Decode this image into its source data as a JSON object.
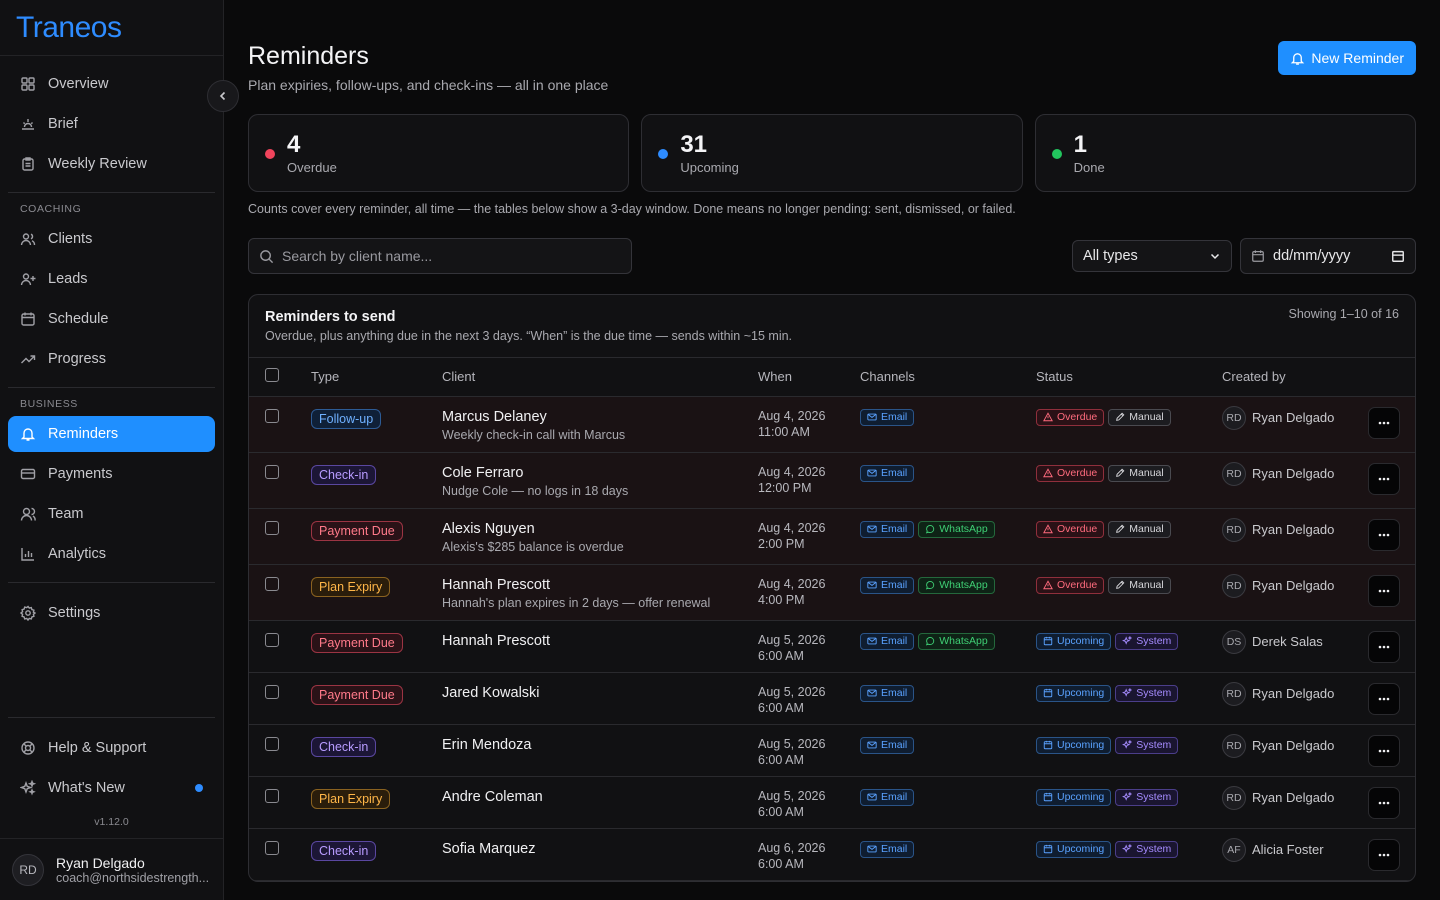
{
  "brand": {
    "name": "Traneos"
  },
  "sidebar": {
    "top_items": [
      {
        "label": "Overview",
        "icon": "grid-icon"
      },
      {
        "label": "Brief",
        "icon": "sunrise-icon"
      },
      {
        "label": "Weekly Review",
        "icon": "clipboard-icon"
      }
    ],
    "coaching_label": "COACHING",
    "coaching_items": [
      {
        "label": "Clients",
        "icon": "users-icon"
      },
      {
        "label": "Leads",
        "icon": "user-plus-icon"
      },
      {
        "label": "Schedule",
        "icon": "calendar-icon"
      },
      {
        "label": "Progress",
        "icon": "trending-up-icon"
      }
    ],
    "business_label": "BUSINESS",
    "business_items": [
      {
        "label": "Reminders",
        "icon": "bell-icon",
        "active": true
      },
      {
        "label": "Payments",
        "icon": "credit-card-icon"
      },
      {
        "label": "Team",
        "icon": "team-icon"
      },
      {
        "label": "Analytics",
        "icon": "bar-chart-icon"
      }
    ],
    "settings_label": "Settings",
    "help_label": "Help & Support",
    "whats_new_label": "What's New",
    "version": "v1.12.0",
    "user": {
      "initials": "RD",
      "name": "Ryan Delgado",
      "email": "coach@northsidestrength..."
    }
  },
  "header": {
    "title": "Reminders",
    "subtitle": "Plan expiries, follow-ups, and check-ins — all in one place",
    "new_button": "New Reminder"
  },
  "stats": [
    {
      "value": "4",
      "label": "Overdue",
      "color": "#f0445c"
    },
    {
      "value": "31",
      "label": "Upcoming",
      "color": "#2e8cff"
    },
    {
      "value": "1",
      "label": "Done",
      "color": "#22c55e"
    }
  ],
  "stats_note": "Counts cover every reminder, all time — the tables below show a 3-day window. Done means no longer pending: sent, dismissed, or failed.",
  "filters": {
    "search_placeholder": "Search by client name...",
    "type_select": "All types",
    "date_placeholder": "dd/mm/yyyy"
  },
  "panel": {
    "title": "Reminders to send",
    "subtitle": "Overdue, plus anything due in the next 3 days. “When” is the due time — sends within ~15 min.",
    "showing": "Showing 1–10 of 16",
    "columns": {
      "type": "Type",
      "client": "Client",
      "when": "When",
      "channels": "Channels",
      "status": "Status",
      "created_by": "Created by"
    }
  },
  "rows": [
    {
      "type": "Follow-up",
      "type_class": "t-follow",
      "client": "Marcus Delaney",
      "note": "Weekly check-in call with Marcus",
      "date": "Aug 4, 2026",
      "time": "11:00 AM",
      "channels": [
        "Email"
      ],
      "status": "Overdue",
      "origin": "Manual",
      "creator_initials": "RD",
      "creator": "Ryan Delgado"
    },
    {
      "type": "Check-in",
      "type_class": "t-check",
      "client": "Cole Ferraro",
      "note": "Nudge Cole — no logs in 18 days",
      "date": "Aug 4, 2026",
      "time": "12:00 PM",
      "channels": [
        "Email"
      ],
      "status": "Overdue",
      "origin": "Manual",
      "creator_initials": "RD",
      "creator": "Ryan Delgado"
    },
    {
      "type": "Payment Due",
      "type_class": "t-pay",
      "client": "Alexis Nguyen",
      "note": "Alexis's $285 balance is overdue",
      "date": "Aug 4, 2026",
      "time": "2:00 PM",
      "channels": [
        "Email",
        "WhatsApp"
      ],
      "status": "Overdue",
      "origin": "Manual",
      "creator_initials": "RD",
      "creator": "Ryan Delgado"
    },
    {
      "type": "Plan Expiry",
      "type_class": "t-plan",
      "client": "Hannah Prescott",
      "note": "Hannah's plan expires in 2 days — offer renewal",
      "date": "Aug 4, 2026",
      "time": "4:00 PM",
      "channels": [
        "Email",
        "WhatsApp"
      ],
      "status": "Overdue",
      "origin": "Manual",
      "creator_initials": "RD",
      "creator": "Ryan Delgado"
    },
    {
      "type": "Payment Due",
      "type_class": "t-pay",
      "client": "Hannah Prescott",
      "note": "",
      "date": "Aug 5, 2026",
      "time": "6:00 AM",
      "channels": [
        "Email",
        "WhatsApp"
      ],
      "status": "Upcoming",
      "origin": "System",
      "creator_initials": "DS",
      "creator": "Derek Salas"
    },
    {
      "type": "Payment Due",
      "type_class": "t-pay",
      "client": "Jared Kowalski",
      "note": "",
      "date": "Aug 5, 2026",
      "time": "6:00 AM",
      "channels": [
        "Email"
      ],
      "status": "Upcoming",
      "origin": "System",
      "creator_initials": "RD",
      "creator": "Ryan Delgado"
    },
    {
      "type": "Check-in",
      "type_class": "t-check",
      "client": "Erin Mendoza",
      "note": "",
      "date": "Aug 5, 2026",
      "time": "6:00 AM",
      "channels": [
        "Email"
      ],
      "status": "Upcoming",
      "origin": "System",
      "creator_initials": "RD",
      "creator": "Ryan Delgado"
    },
    {
      "type": "Plan Expiry",
      "type_class": "t-plan",
      "client": "Andre Coleman",
      "note": "",
      "date": "Aug 5, 2026",
      "time": "6:00 AM",
      "channels": [
        "Email"
      ],
      "status": "Upcoming",
      "origin": "System",
      "creator_initials": "RD",
      "creator": "Ryan Delgado"
    },
    {
      "type": "Check-in",
      "type_class": "t-check",
      "client": "Sofia Marquez",
      "note": "",
      "date": "Aug 6, 2026",
      "time": "6:00 AM",
      "channels": [
        "Email"
      ],
      "status": "Upcoming",
      "origin": "System",
      "creator_initials": "AF",
      "creator": "Alicia Foster"
    }
  ]
}
